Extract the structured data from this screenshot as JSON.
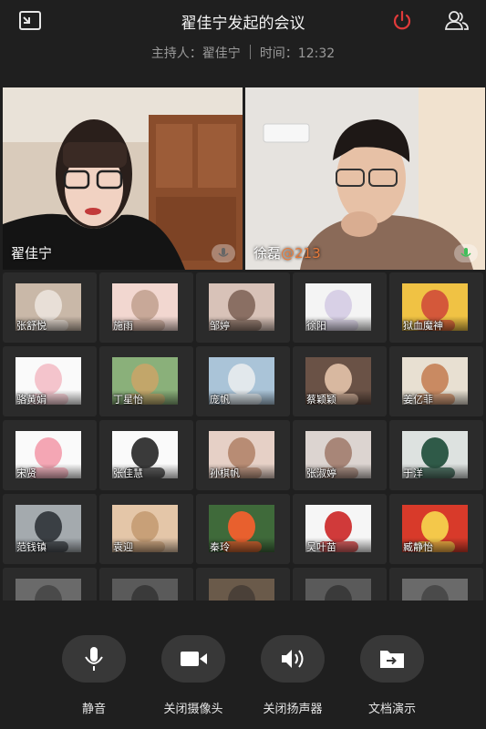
{
  "meeting": {
    "title": "翟佳宁发起的会议",
    "host_label": "主持人：翟佳宁",
    "time_label": "时间：12:32"
  },
  "icons": {
    "exit_fullscreen": "shrink-window-icon",
    "hangup": "power-icon",
    "participants": "people-icon"
  },
  "colors": {
    "hangup": "#e03a3a",
    "accent_name": "#e87a3a",
    "mic_active": "#3fbf5a"
  },
  "main_videos": [
    {
      "name": "翟佳宁",
      "suffix": ""
    },
    {
      "name": "徐磊",
      "suffix": "@213"
    }
  ],
  "participants": [
    "张舒悦",
    "施雨",
    "邹婷",
    "徐阳",
    "狱血魔神",
    "骆黄娟",
    "丁星怡",
    "庞帆",
    "蔡颖颖",
    "姜亿菲",
    "宋贤",
    "张佳慧",
    "孙棋帆",
    "张淑婷",
    "于洋",
    "范钱镇",
    "袁迎",
    "秦玲",
    "吴叶苗",
    "臧静怡",
    "",
    "",
    "",
    "",
    ""
  ],
  "controls": [
    {
      "label": "静音",
      "icon": "microphone-icon"
    },
    {
      "label": "关闭摄像头",
      "icon": "video-camera-icon"
    },
    {
      "label": "关闭扬声器",
      "icon": "speaker-icon"
    },
    {
      "label": "文档演示",
      "icon": "share-document-icon"
    }
  ]
}
